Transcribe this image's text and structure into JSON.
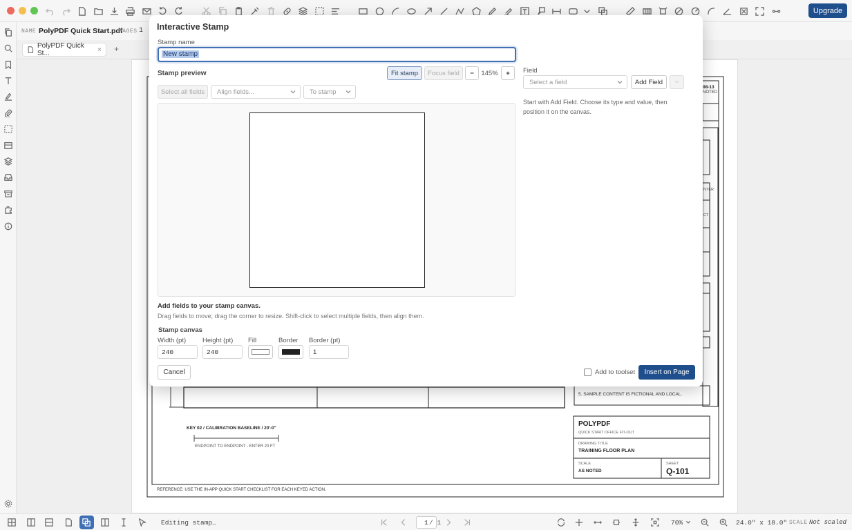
{
  "window": {
    "traffic_colors": [
      "#ed6a5e",
      "#f5bf4f",
      "#61c554"
    ],
    "upgrade_label": "Upgrade"
  },
  "toolbar_icons": [
    "undo-icon",
    "redo-icon",
    "new-file-icon",
    "open-folder-icon",
    "download-icon",
    "print-icon",
    "mail-icon",
    "rotate-left-icon",
    "rotate-right-icon",
    "cut-icon",
    "copy-icon",
    "paste-icon",
    "clean-icon",
    "delete-icon",
    "link-icon",
    "layers-icon",
    "select-area-icon",
    "align-icon",
    "rectangle-icon",
    "ellipse-icon",
    "arc-icon",
    "cloud-icon",
    "arrow-icon",
    "line-icon",
    "polyline-icon",
    "polygon-icon",
    "pencil-icon",
    "highlighter-icon",
    "textbox-icon",
    "callout-icon",
    "dimension-icon",
    "stamp-icon",
    "chevron-down-icon",
    "attach-icon",
    "measure-icon",
    "area-measure-icon",
    "perimeter-icon",
    "diameter-icon",
    "radius-icon",
    "curve-icon",
    "angle-icon",
    "crop-icon",
    "fullscreen-icon",
    "more-icon"
  ],
  "namerow": {
    "name_caption": "NAME",
    "file_name": "PolyPDF Quick Start.pdf",
    "pages_caption": "PAGES",
    "pages_value": "1"
  },
  "tab": {
    "label": "PolyPDF Quick St...",
    "close": "×",
    "add": "+"
  },
  "drawing": {
    "titleblock_date": "08-13",
    "titleblock_noted": "NOTED",
    "side_label_1": "NTER",
    "side_label_2": "CT",
    "note_5": "5. SAMPLE CONTENT IS FICTIONAL AND LOCAL.",
    "key_title": "KEY 02 / CALIBRATION BASELINE / 20'-0\"",
    "key_caption": "ENDPOINT TO ENDPOINT - ENTER 20 FT",
    "company": "POLYPDF",
    "project": "QUICK START OFFICE FIT-OUT",
    "drawing_title_caption": "DRAWING TITLE",
    "drawing_title": "TRAINING FLOOR PLAN",
    "scale_caption": "SCALE",
    "scale_value": "AS NOTED",
    "sheet_caption": "SHEET",
    "sheet_value": "Q-101",
    "reference": "REFERENCE: USE THE IN-APP QUICK START CHECKLIST FOR EACH KEYED ACTION."
  },
  "dialog": {
    "title": "Interactive Stamp",
    "stamp_name_label": "Stamp name",
    "stamp_name_value": "New stamp",
    "preview_label": "Stamp preview",
    "fit_stamp": "Fit stamp",
    "focus_field": "Focus field",
    "zoom_out": "−",
    "zoom_value": "145%",
    "zoom_in": "+",
    "select_all_fields": "Select all fields",
    "align_fields": "Align fields...",
    "to_stamp": "To stamp",
    "add_fields_heading": "Add fields to your stamp canvas.",
    "add_fields_help": "Drag fields to move; drag the corner to resize. Shift-click to select multiple fields, then align them.",
    "canvas_heading": "Stamp canvas",
    "width_label": "Width (pt)",
    "width_value": "240",
    "height_label": "Height (pt)",
    "height_value": "240",
    "fill_label": "Fill",
    "border_label": "Border",
    "border_pt_label": "Border (pt)",
    "border_pt_value": "1",
    "fill_color": "#ffffff",
    "border_color": "#222222",
    "field_label": "Field",
    "field_placeholder": "Select a field",
    "add_field": "Add Field",
    "remove_field": "−",
    "field_help": "Start with Add Field. Choose its type and value, then position it on the canvas.",
    "cancel": "Cancel",
    "add_to_toolset": "Add to toolset",
    "insert_on_page": "Insert on Page"
  },
  "statusbar": {
    "status_text": "Editing stamp…",
    "page_current": "1",
    "page_total": "/ 1",
    "zoom": "70%",
    "page_size": "24.0\" x 18.0\"",
    "scale_caption": "SCALE",
    "scale_value": "Not scaled"
  }
}
